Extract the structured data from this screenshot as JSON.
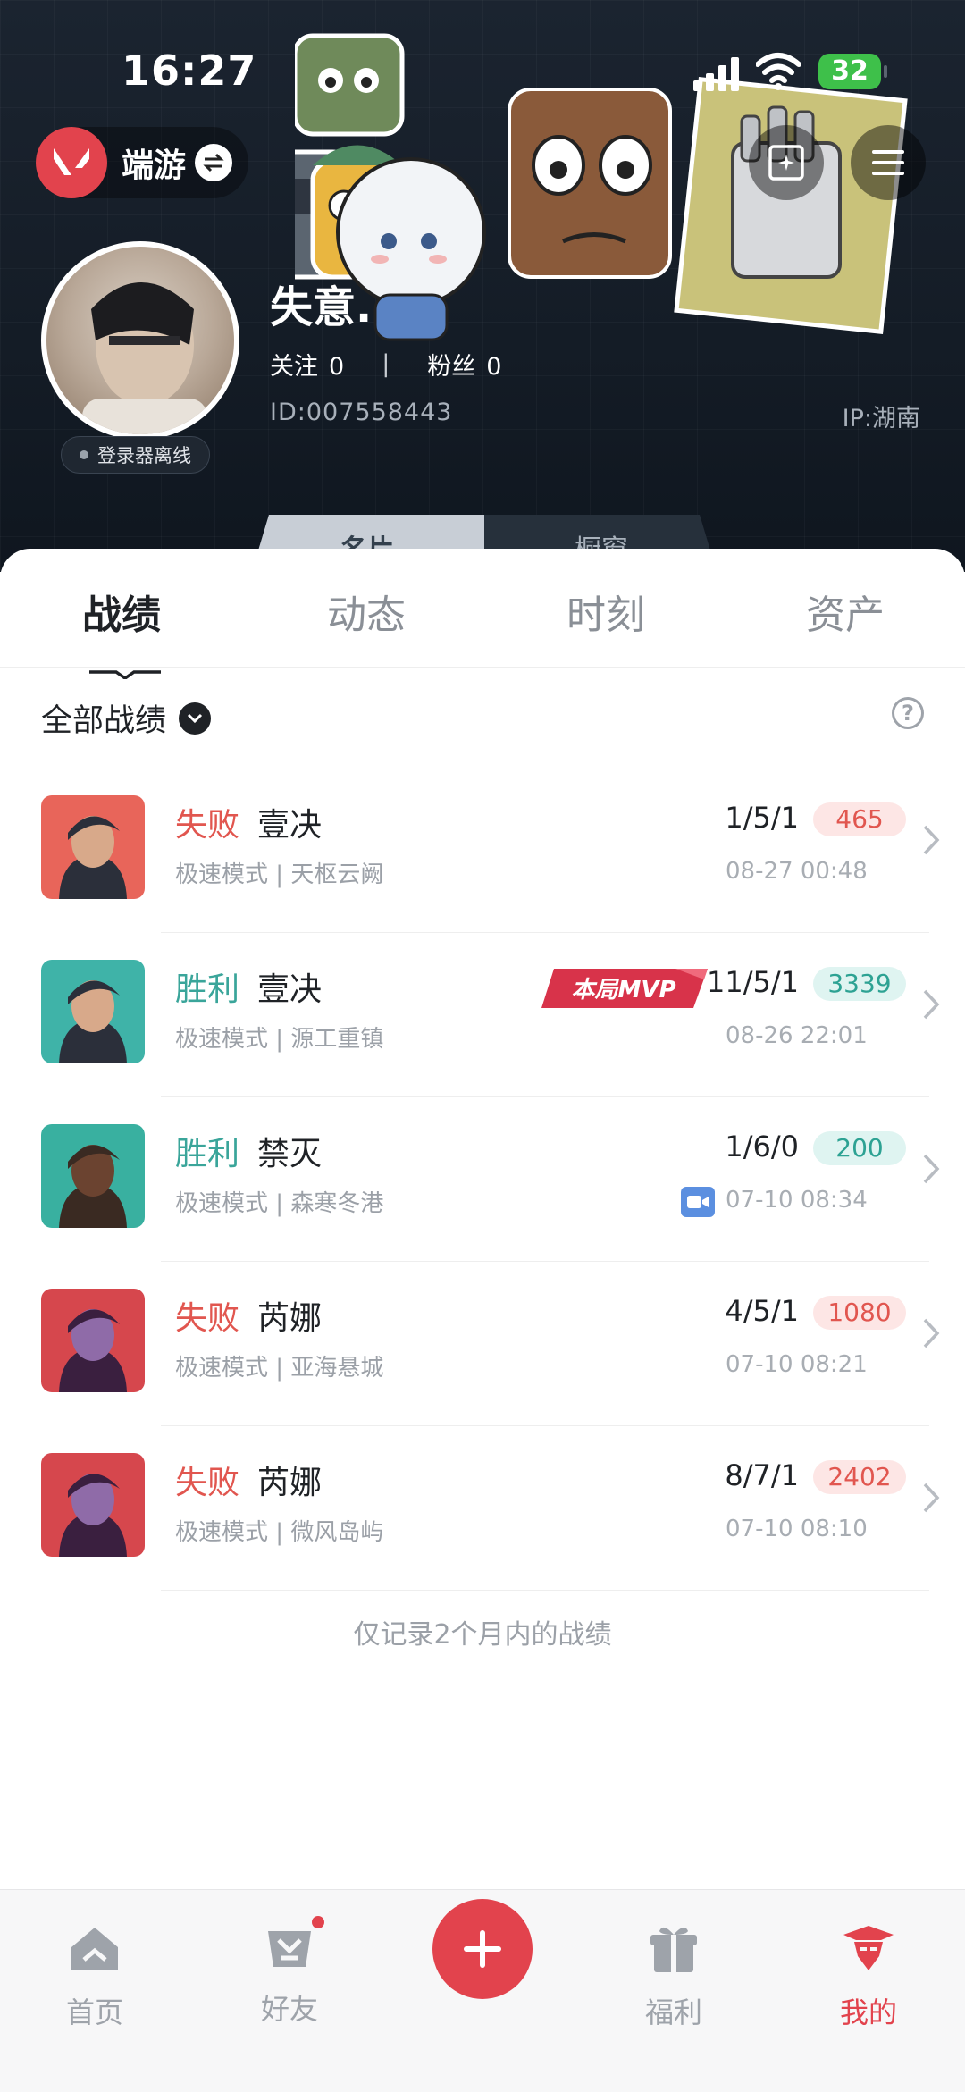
{
  "status_bar": {
    "time": "16:27",
    "battery": "32"
  },
  "header": {
    "app_name": "端游",
    "username": "失意.",
    "follow_label": "关注",
    "follow_count": "0",
    "fans_label": "粉丝",
    "fans_count": "0",
    "user_id": "ID:007558443",
    "ip": "IP:湖南",
    "login_status": "登录器离线",
    "card_tabs": [
      "名片",
      "橱窗"
    ]
  },
  "tabs": [
    "战绩",
    "动态",
    "时刻",
    "资产"
  ],
  "filter": {
    "label": "全部战绩"
  },
  "matches": [
    {
      "result": "失败",
      "outcome": "loss",
      "agent": "壹决",
      "mode": "极速模式",
      "map": "天枢云阙",
      "kda": "1/5/1",
      "score": "465",
      "date": "08-27 00:48",
      "mvp": false,
      "video": false
    },
    {
      "result": "胜利",
      "outcome": "win",
      "agent": "壹决",
      "mode": "极速模式",
      "map": "源工重镇",
      "kda": "11/5/1",
      "score": "3339",
      "date": "08-26 22:01",
      "mvp": true,
      "mvp_label": "本局MVP",
      "video": false
    },
    {
      "result": "胜利",
      "outcome": "win",
      "agent": "禁灭",
      "mode": "极速模式",
      "map": "森寒冬港",
      "kda": "1/6/0",
      "score": "200",
      "date": "07-10 08:34",
      "mvp": false,
      "video": true
    },
    {
      "result": "失败",
      "outcome": "loss",
      "agent": "芮娜",
      "mode": "极速模式",
      "map": "亚海悬城",
      "kda": "4/5/1",
      "score": "1080",
      "date": "07-10 08:21",
      "mvp": false,
      "video": false
    },
    {
      "result": "失败",
      "outcome": "loss",
      "agent": "芮娜",
      "mode": "极速模式",
      "map": "微风岛屿",
      "kda": "8/7/1",
      "score": "2402",
      "date": "07-10 08:10",
      "mvp": false,
      "video": false
    }
  ],
  "footnote": "仅记录2个月内的战绩",
  "bottom_nav": [
    {
      "label": "首页",
      "icon": "home-icon"
    },
    {
      "label": "好友",
      "icon": "friends-icon"
    },
    {
      "label": "",
      "icon": "plus-icon"
    },
    {
      "label": "福利",
      "icon": "gift-icon"
    },
    {
      "label": "我的",
      "icon": "profile-icon"
    }
  ],
  "colors": {
    "accent": "#e2434d",
    "win": "#3aa59a",
    "loss": "#e1564f",
    "header_bg": "#1b2430"
  }
}
